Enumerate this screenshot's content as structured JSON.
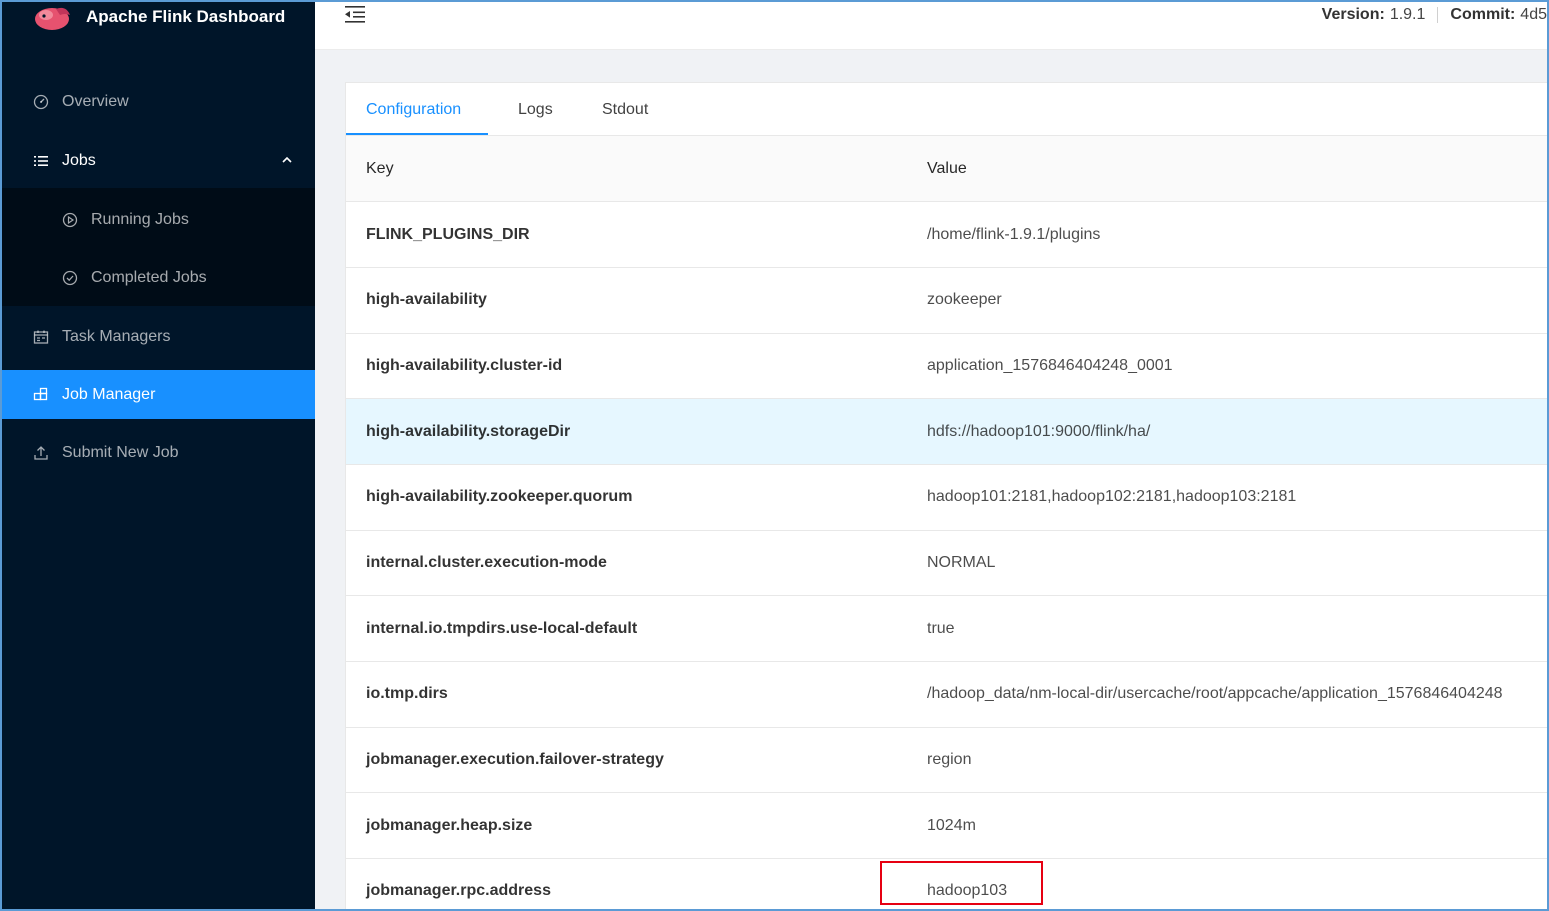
{
  "app": {
    "title": "Apache Flink Dashboard",
    "logo_icon": "flink-squirrel-logo"
  },
  "sidebar": {
    "items": [
      {
        "label": "Overview",
        "icon": "dashboard-icon"
      },
      {
        "label": "Jobs",
        "icon": "list-icon",
        "expanded": true
      },
      {
        "label": "Running Jobs",
        "icon": "play-circle-icon"
      },
      {
        "label": "Completed Jobs",
        "icon": "check-circle-icon"
      },
      {
        "label": "Task Managers",
        "icon": "schedule-icon"
      },
      {
        "label": "Job Manager",
        "icon": "build-icon",
        "active": true
      },
      {
        "label": "Submit New Job",
        "icon": "upload-icon"
      }
    ]
  },
  "header": {
    "version_label": "Version:",
    "version_value": "1.9.1",
    "commit_label": "Commit:",
    "commit_value": "4d5"
  },
  "tabs": [
    {
      "label": "Configuration",
      "active": true
    },
    {
      "label": "Logs"
    },
    {
      "label": "Stdout"
    }
  ],
  "table": {
    "columns": [
      "Key",
      "Value"
    ],
    "rows": [
      {
        "key": "FLINK_PLUGINS_DIR",
        "value": "/home/flink-1.9.1/plugins"
      },
      {
        "key": "high-availability",
        "value": "zookeeper"
      },
      {
        "key": "high-availability.cluster-id",
        "value": "application_1576846404248_0001"
      },
      {
        "key": "high-availability.storageDir",
        "value": "hdfs://hadoop101:9000/flink/ha/",
        "highlighted": true
      },
      {
        "key": "high-availability.zookeeper.quorum",
        "value": "hadoop101:2181,hadoop102:2181,hadoop103:2181"
      },
      {
        "key": "internal.cluster.execution-mode",
        "value": "NORMAL"
      },
      {
        "key": "internal.io.tmpdirs.use-local-default",
        "value": "true"
      },
      {
        "key": "io.tmp.dirs",
        "value": "/hadoop_data/nm-local-dir/usercache/root/appcache/application_1576846404248"
      },
      {
        "key": "jobmanager.execution.failover-strategy",
        "value": "region"
      },
      {
        "key": "jobmanager.heap.size",
        "value": "1024m"
      },
      {
        "key": "jobmanager.rpc.address",
        "value": "hadoop103"
      }
    ]
  },
  "colors": {
    "sidebar_bg": "#001529",
    "accent": "#1890ff",
    "highlight_row": "#e6f7ff",
    "annotation_box": "#e60012"
  }
}
